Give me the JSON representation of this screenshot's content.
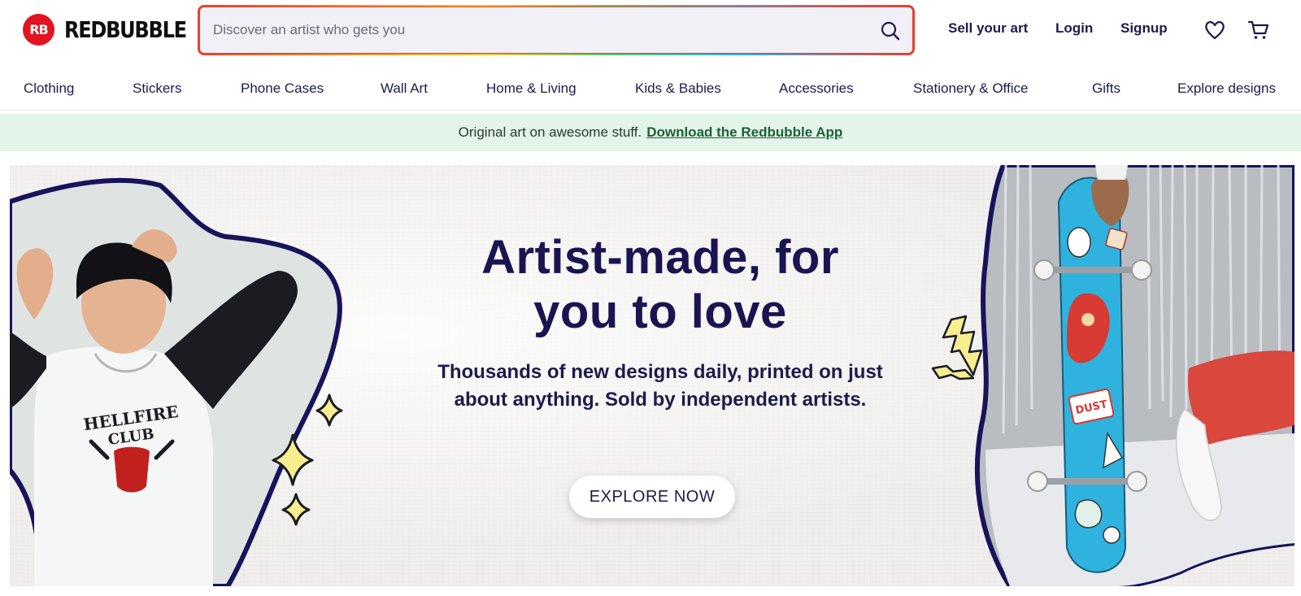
{
  "brand": {
    "name": "REDBUBBLE",
    "mark_text": "RB",
    "color": "#e41321"
  },
  "search": {
    "placeholder": "Discover an artist who gets you",
    "value": "",
    "icon": "search-icon"
  },
  "header_links": {
    "sell": "Sell your art",
    "login": "Login",
    "signup": "Signup"
  },
  "header_icons": {
    "wishlist": "heart-icon",
    "cart": "cart-icon"
  },
  "categories": [
    "Clothing",
    "Stickers",
    "Phone Cases",
    "Wall Art",
    "Home & Living",
    "Kids & Babies",
    "Accessories",
    "Stationery & Office",
    "Gifts",
    "Explore designs"
  ],
  "promo": {
    "text": "Original art on awesome stuff.",
    "link": "Download the Redbubble App",
    "background": "#e2f5e8"
  },
  "hero": {
    "title_line1": "Artist-made, for",
    "title_line2": "you to love",
    "subtitle": "Thousands of new designs daily, printed on just about anything. Sold by independent artists.",
    "cta": "EXPLORE NOW",
    "left_shirt_print_line1": "HELLFIRE",
    "left_shirt_print_line2": "CLUB",
    "skateboard_sticker_text": "DUST"
  }
}
